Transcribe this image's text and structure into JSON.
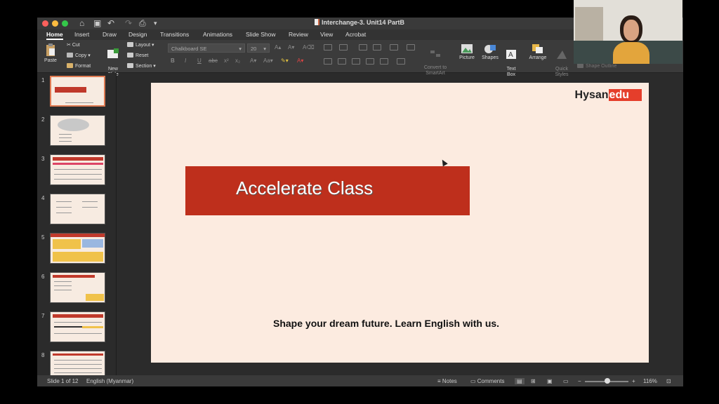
{
  "window": {
    "title": "Interchange-3. Unit14 PartB"
  },
  "tabs": [
    "Home",
    "Insert",
    "Draw",
    "Design",
    "Transitions",
    "Animations",
    "Slide Show",
    "Review",
    "View",
    "Acrobat"
  ],
  "ribbon": {
    "paste": "Paste",
    "cut": "Cut",
    "copy": "Copy",
    "format": "Format",
    "new_slide": "New\nSlide",
    "layout": "Layout",
    "reset": "Reset",
    "section": "Section",
    "font_name": "Chalkboard SE",
    "font_size": "20",
    "convert_smartart": "Convert to\nSmartArt",
    "picture": "Picture",
    "shapes": "Shapes",
    "text_box": "Text\nBox",
    "arrange": "Arrange",
    "quick_styles": "Quick\nStyles",
    "shape_outline": "Shape Outline"
  },
  "slide_numbers": [
    "1",
    "2",
    "3",
    "4",
    "5",
    "6",
    "7",
    "8"
  ],
  "slide": {
    "title": "Accelerate Class",
    "logo_left": "Hysan",
    "logo_right": "edu",
    "tagline": "Shape your dream future. Learn English with us."
  },
  "status": {
    "slide_counter": "Slide 1 of 12",
    "language": "English (Myanmar)",
    "notes": "Notes",
    "comments": "Comments",
    "zoom": "116%"
  },
  "colors": {
    "banner": "#be2f1c",
    "slide_bg": "#fcebe0",
    "selected_thumb": "#e07b53"
  }
}
